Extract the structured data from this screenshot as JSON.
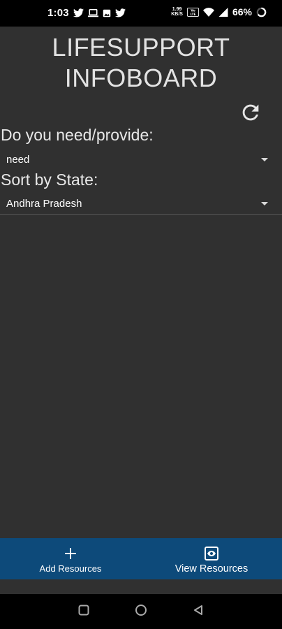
{
  "status_bar": {
    "time": "1:03",
    "speed_value": "1.99",
    "speed_unit": "KB/S",
    "battery_percent": "66%",
    "left_icons": [
      "twitter-icon",
      "laptop-icon",
      "image-icon",
      "twitter-icon"
    ],
    "right_icons": [
      "volte-icon",
      "wifi-icon",
      "signal-icon",
      "battery-ring-icon"
    ]
  },
  "header": {
    "title_line1": "LIFESUPPORT",
    "title_line2": "INFOBOARD",
    "refresh_icon": "refresh-icon"
  },
  "filters": {
    "need_label": "Do you need/provide:",
    "need_value": "need",
    "state_label": "Sort by State:",
    "state_value": "Andhra Pradesh"
  },
  "bottom_nav": {
    "add_label": "Add Resources",
    "view_label": "View Resources",
    "add_icon": "plus-icon",
    "view_icon": "eye-icon"
  },
  "colors": {
    "background": "#303030",
    "bottom_nav": "#0d4a7a",
    "status_bar": "#000000"
  }
}
